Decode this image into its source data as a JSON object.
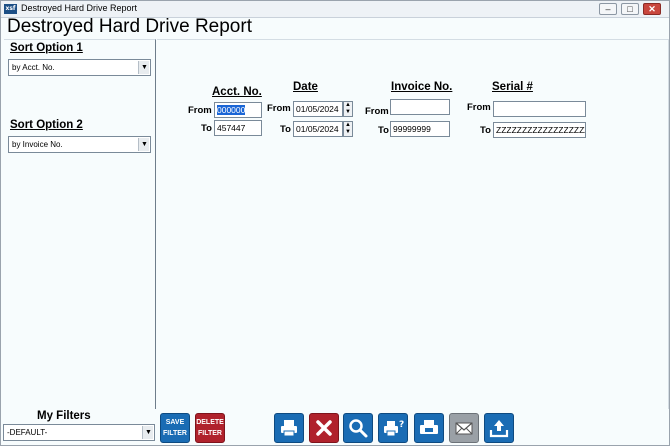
{
  "window": {
    "title": "Destroyed Hard Drive Report",
    "icon_text": "xsf"
  },
  "report_title": "Destroyed Hard Drive Report",
  "sort": {
    "option1_label": "Sort Option 1",
    "option1_value": "by Acct. No.",
    "option2_label": "Sort Option 2",
    "option2_value": "by Invoice No."
  },
  "filters": {
    "acct": {
      "heading": "Acct. No.",
      "from_label": "From",
      "to_label": "To",
      "from": "000000",
      "to": "457447"
    },
    "date": {
      "heading": "Date",
      "from_label": "From",
      "to_label": "To",
      "from": "01/05/2024",
      "to": "01/05/2024"
    },
    "invoice": {
      "heading": "Invoice No.",
      "from_label": "From",
      "to_label": "To",
      "from": "",
      "to": "99999999"
    },
    "serial": {
      "heading": "Serial #",
      "from_label": "From",
      "to_label": "To",
      "from": "",
      "to": "ZZZZZZZZZZZZZZZZZZZZ"
    }
  },
  "my_filters": {
    "label": "My Filters",
    "value": "-DEFAULT-"
  },
  "toolbar": {
    "save_filter_line1": "SAVE",
    "save_filter_line2": "FILTER",
    "delete_filter_line1": "DELETE",
    "delete_filter_line2": "FILTER",
    "icons": [
      "print-icon",
      "cancel-icon",
      "search-icon",
      "print-preview-icon",
      "fax-icon",
      "email-icon",
      "export-icon"
    ]
  },
  "colors": {
    "accent_blue": "#1a6cb4",
    "accent_red": "#b0222c",
    "selection": "#1a66d6"
  }
}
